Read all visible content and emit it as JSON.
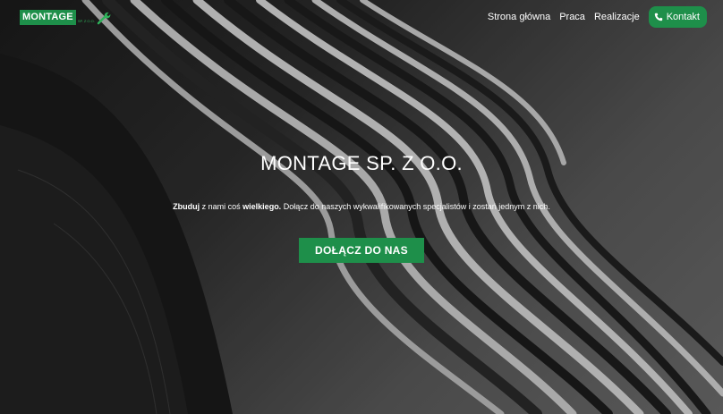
{
  "logo": {
    "text": "MONTAGE",
    "sub": "SP. Z O.O."
  },
  "nav": {
    "items": [
      {
        "label": "Strona główna"
      },
      {
        "label": "Praca"
      },
      {
        "label": "Realizacje"
      }
    ],
    "contact_label": "Kontakt"
  },
  "hero": {
    "title": "MONTAGE SP. Z O.O.",
    "subtitle": {
      "bold1": "Zbuduj",
      "t1": " z nami coś ",
      "bold2": "wielkiego.",
      "t2": " Dołącz do naszych wykwalifikowanych specjalistów i zostań jednym z nich."
    },
    "cta_label": "DOŁĄCZ DO NAS"
  },
  "colors": {
    "brand_green": "#1e8f4a",
    "text": "#ffffff"
  },
  "icons": [
    "wrench-icon",
    "phone-icon"
  ]
}
